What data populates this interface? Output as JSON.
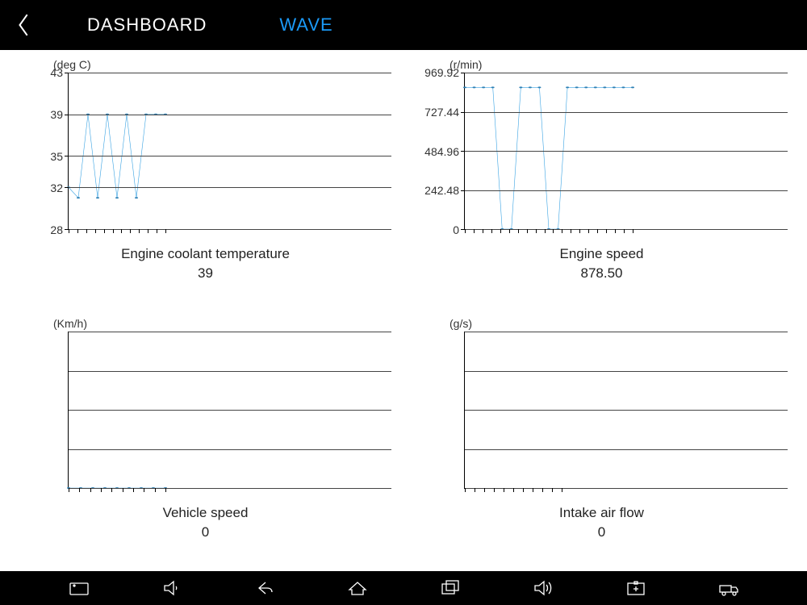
{
  "header": {
    "tab_dashboard": "DASHBOARD",
    "tab_wave": "WAVE"
  },
  "charts": [
    {
      "unit": "(deg C)",
      "title": "Engine coolant temperature",
      "value": "39"
    },
    {
      "unit": "(r/min)",
      "title": "Engine speed",
      "value": "878.50"
    },
    {
      "unit": "(Km/h)",
      "title": "Vehicle speed",
      "value": "0"
    },
    {
      "unit": "(g/s)",
      "title": "Intake air flow",
      "value": "0"
    }
  ],
  "chart_data": [
    {
      "type": "line",
      "title": "Engine coolant temperature",
      "xlabel": "",
      "ylabel": "deg C",
      "ylim": [
        28,
        43
      ],
      "yticks": [
        28,
        32,
        35,
        39,
        43
      ],
      "x": [
        0,
        1,
        2,
        3,
        4,
        5,
        6,
        7,
        8,
        9,
        10
      ],
      "values": [
        32,
        31,
        39,
        31,
        39,
        31,
        39,
        31,
        39,
        39,
        39
      ],
      "current": 39
    },
    {
      "type": "line",
      "title": "Engine speed",
      "xlabel": "",
      "ylabel": "r/min",
      "ylim": [
        0,
        969.92
      ],
      "yticks": [
        0.0,
        242.48,
        484.96,
        727.44,
        969.92
      ],
      "x": [
        0,
        1,
        2,
        3,
        4,
        5,
        6,
        7,
        8,
        9,
        10,
        11,
        12,
        13,
        14,
        15,
        16,
        17,
        18
      ],
      "values": [
        878,
        878,
        878,
        878,
        0,
        0,
        878,
        878,
        878,
        0,
        0,
        878,
        878,
        878,
        878,
        878,
        878,
        878,
        878
      ],
      "current": 878.5
    },
    {
      "type": "line",
      "title": "Vehicle speed",
      "xlabel": "",
      "ylabel": "Km/h",
      "ylim": [
        0,
        1
      ],
      "yticks": [],
      "x": [
        0,
        1,
        2,
        3,
        4,
        5,
        6,
        7,
        8
      ],
      "values": [
        0,
        0,
        0,
        0,
        0,
        0,
        0,
        0,
        0
      ],
      "current": 0
    },
    {
      "type": "line",
      "title": "Intake air flow",
      "xlabel": "",
      "ylabel": "g/s",
      "ylim": [
        0,
        1
      ],
      "yticks": [],
      "x": [],
      "values": [],
      "current": 0
    }
  ]
}
